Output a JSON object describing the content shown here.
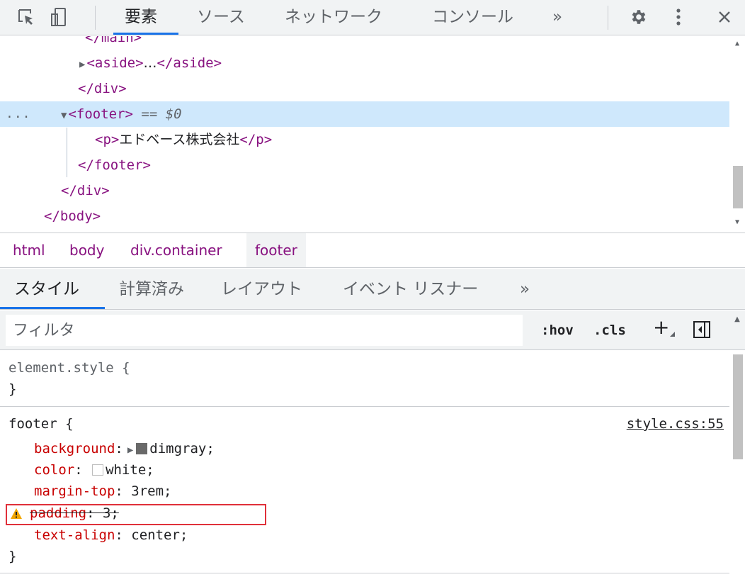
{
  "toolbar": {
    "tabs": [
      "要素",
      "ソース",
      "ネットワーク",
      "コンソール"
    ],
    "more": "»",
    "icons": [
      "inspect-element-icon",
      "device-toolbar-icon",
      "settings-gear-icon",
      "more-vert-icon",
      "close-icon"
    ]
  },
  "dom": {
    "line0": "</main>",
    "line1_open": "<aside>",
    "line1_ellipsis": "…",
    "line1_close": "</aside>",
    "line2": "</div>",
    "line3_dots": "...",
    "line3_tag": "<footer>",
    "line3_eq": "== $0",
    "line4_open": "<p>",
    "line4_text": "エドベース株式会社",
    "line4_close": "</p>",
    "line5": "</footer>",
    "line6": "</div>",
    "line7": "</body>"
  },
  "breadcrumb": [
    "html",
    "body",
    "div.container",
    "footer"
  ],
  "subtabs": [
    "スタイル",
    "計算済み",
    "レイアウト",
    "イベント リスナー"
  ],
  "subtabs_more": "»",
  "filter": {
    "placeholder": "フィルタ",
    "hov": ":hov",
    "cls": ".cls",
    "add": "+"
  },
  "styles": {
    "element_style_selector": "element.style {",
    "close_brace": "}",
    "footer_selector": "footer {",
    "footer_source": "style.css:55",
    "props": [
      {
        "name": "background",
        "value": "dimgray;",
        "swatch": "#696969"
      },
      {
        "name": "color",
        "value": "white;",
        "swatch": "#ffffff"
      },
      {
        "name": "margin-top",
        "value": "3rem;"
      },
      {
        "name": "padding",
        "value": "3;",
        "invalid": true
      },
      {
        "name": "text-align",
        "value": "center;"
      }
    ]
  },
  "colors": {
    "accent": "#1a73e8",
    "selected_row": "#cfe8fc",
    "tag": "#881280",
    "prop": "#c80000",
    "warning_box": "#e0303a"
  }
}
